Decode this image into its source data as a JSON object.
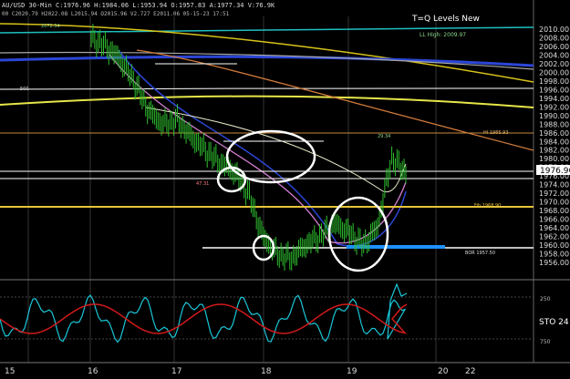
{
  "header": {
    "line1": "AU/USD  30-Min  C:1976.96  H:1984.06  L:1953.94  O:1957.83  A:1977.34  V:76.9K",
    "line2": "00  C2020.79  H2022.08  L2015.94  O2015.96  V2.727  E2011.06  05-15-23 17:51"
  },
  "title": "T=Q Levels New",
  "labels": {
    "ll_high": "LL High: 2009.97",
    "level_2072": "2072.54",
    "level_500": "500",
    "low_4731": "47.31",
    "level_2934": "29.34",
    "level_1985": "HI 1985.93",
    "level_1968": "Fib 1968.90",
    "level_1957": "BOR 1957.50",
    "stoch_label": "STO 24",
    "stoch_250": "250",
    "stoch_750": "750"
  },
  "price_badge": "1976.96",
  "colors": {
    "price": "#2fbf2f",
    "stoch_k": "#19c7d9",
    "stoch_d": "#d11a1a",
    "badge_bg": "#ffffff"
  },
  "chart_data": {
    "type": "line",
    "price_axis": [
      2010,
      2008,
      2006,
      2004,
      2002,
      2000,
      1998,
      1996,
      1994,
      1992,
      1990,
      1988,
      1986,
      1984,
      1982,
      1980,
      1978,
      1976,
      1974,
      1972,
      1970,
      1968,
      1966,
      1964,
      1962,
      1960,
      1958,
      1956
    ],
    "x_axis": [
      "15",
      "16",
      "17",
      "18",
      "19",
      "20",
      "22"
    ],
    "series": [
      {
        "values": [
          2008,
          2006,
          2003,
          1998,
          1991,
          1988,
          1989,
          1985,
          1982,
          1979,
          1977,
          1972,
          1962,
          1958,
          1957,
          1960,
          1962,
          1965,
          1963,
          1960,
          1964,
          1980,
          1977
        ]
      }
    ],
    "horizontal_levels": [
      1987.0,
      1978.0,
      1976.96,
      1968.5,
      1958.5
    ]
  }
}
